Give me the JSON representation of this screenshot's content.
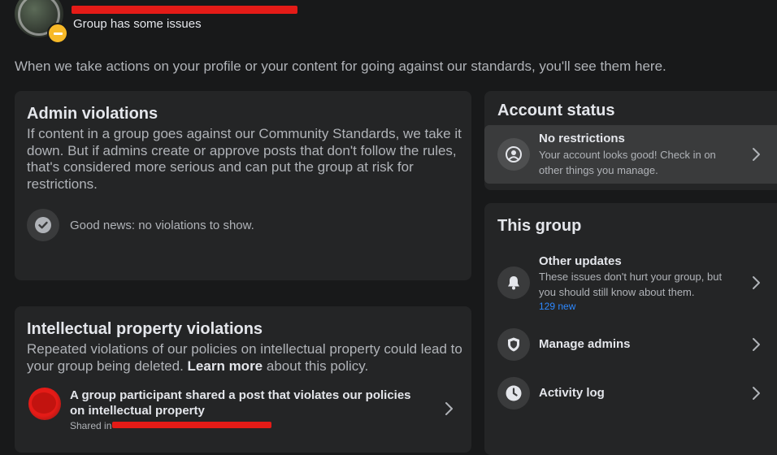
{
  "header": {
    "group_status": "Group has some issues"
  },
  "intro": "When we take actions on your profile or your content for going against our standards, you'll see them here.",
  "admin_violations": {
    "title": "Admin violations",
    "description": "If content in a group goes against our Community Standards, we take it down. But if admins create or approve posts that don't follow the rules, that's considered more serious and can put the group at risk for restrictions.",
    "good_news": "Good news: no violations to show."
  },
  "ip_violations": {
    "title": "Intellectual property violations",
    "description_start": "Repeated violations of our policies on intellectual property could lead to your group being deleted.",
    "learn_more": "Learn more",
    "description_end": "about this policy.",
    "item_title": "A group participant shared a post that violates our policies on intellectual property",
    "shared_in": "Shared in"
  },
  "account_status": {
    "title": "Account status",
    "row_title": "No restrictions",
    "row_sub": "Your account looks good! Check in on other things you manage."
  },
  "this_group": {
    "title": "This group",
    "other_updates_title": "Other updates",
    "other_updates_sub": "These issues don't hurt your group, but you should still know about them.",
    "other_updates_count": "129 new",
    "manage_admins": "Manage admins",
    "activity_log": "Activity log"
  },
  "colors": {
    "background": "#18191a",
    "card": "#242526",
    "accent_blue": "#2d88ff",
    "status_yellow": "#f7b928",
    "redaction": "#e41b17"
  },
  "icons": [
    "minus-icon",
    "check-circle-icon",
    "user-circle-icon",
    "bell-icon",
    "shield-icon",
    "clock-icon",
    "chevron-right-icon"
  ]
}
